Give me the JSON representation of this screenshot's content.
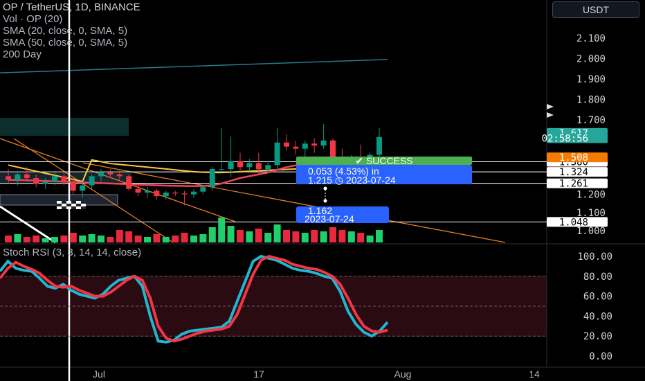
{
  "header": {
    "title": "OP / TetherUS, 1D, BINANCE",
    "indicators": [
      "Vol · OP (20)",
      "SMA (20, close, 0, SMA, 5)",
      "SMA (50, close, 0, SMA, 5)",
      "200 Day"
    ],
    "currency_button": "USDT"
  },
  "stoch_label": "Stoch RSI (3, 3, 14, 14, close)",
  "colors": {
    "up": "#26e07f",
    "down": "#f23645",
    "up_candle": "#089981",
    "down_candle": "#f23645",
    "sma20": "#f2425a",
    "sma50": "#f7c948",
    "ma200": "#2a7a8c",
    "stoch_k": "#21b6d0",
    "stoch_d": "#f23645",
    "accent_blue": "#2962ff",
    "success_green": "#4caf50"
  },
  "chart_data": [
    {
      "type": "candlestick",
      "title": "OP / TetherUS, 1D, BINANCE",
      "y_ticks": [
        "2.100",
        "2.000",
        "1.900",
        "1.800",
        "1.700",
        "1.200",
        "1.100",
        "1.000"
      ],
      "ylim": [
        0.98,
        2.22
      ],
      "x_ticks": [
        "Jul",
        "17",
        "Aug",
        "14"
      ],
      "candles": [
        {
          "o": 1.3,
          "h": 1.34,
          "l": 1.26,
          "c": 1.28
        },
        {
          "o": 1.28,
          "h": 1.33,
          "l": 1.25,
          "c": 1.31
        },
        {
          "o": 1.31,
          "h": 1.35,
          "l": 1.27,
          "c": 1.29
        },
        {
          "o": 1.29,
          "h": 1.31,
          "l": 1.24,
          "c": 1.26
        },
        {
          "o": 1.26,
          "h": 1.29,
          "l": 1.23,
          "c": 1.27
        },
        {
          "o": 1.27,
          "h": 1.32,
          "l": 1.25,
          "c": 1.3
        },
        {
          "o": 1.3,
          "h": 1.32,
          "l": 1.25,
          "c": 1.27
        },
        {
          "o": 1.27,
          "h": 1.29,
          "l": 1.2,
          "c": 1.22
        },
        {
          "o": 1.22,
          "h": 1.27,
          "l": 1.18,
          "c": 1.25
        },
        {
          "o": 1.25,
          "h": 1.31,
          "l": 1.23,
          "c": 1.3
        },
        {
          "o": 1.3,
          "h": 1.34,
          "l": 1.27,
          "c": 1.32
        },
        {
          "o": 1.32,
          "h": 1.34,
          "l": 1.29,
          "c": 1.31
        },
        {
          "o": 1.31,
          "h": 1.33,
          "l": 1.28,
          "c": 1.3
        },
        {
          "o": 1.3,
          "h": 1.31,
          "l": 1.22,
          "c": 1.23
        },
        {
          "o": 1.23,
          "h": 1.26,
          "l": 1.19,
          "c": 1.21
        },
        {
          "o": 1.21,
          "h": 1.24,
          "l": 1.18,
          "c": 1.22
        },
        {
          "o": 1.22,
          "h": 1.23,
          "l": 1.17,
          "c": 1.19
        },
        {
          "o": 1.19,
          "h": 1.22,
          "l": 1.17,
          "c": 1.21
        },
        {
          "o": 1.21,
          "h": 1.22,
          "l": 1.19,
          "c": 1.205
        },
        {
          "o": 1.205,
          "h": 1.22,
          "l": 1.14,
          "c": 1.2
        },
        {
          "o": 1.2,
          "h": 1.23,
          "l": 1.18,
          "c": 1.215
        },
        {
          "o": 1.215,
          "h": 1.25,
          "l": 1.2,
          "c": 1.24
        },
        {
          "o": 1.24,
          "h": 1.35,
          "l": 1.22,
          "c": 1.34
        },
        {
          "o": 1.34,
          "h": 1.66,
          "l": 1.33,
          "c": 1.46
        },
        {
          "o": 1.46,
          "h": 1.62,
          "l": 1.42,
          "c": 1.5
        },
        {
          "o": 1.5,
          "h": 1.54,
          "l": 1.44,
          "c": 1.47
        },
        {
          "o": 1.47,
          "h": 1.51,
          "l": 1.45,
          "c": 1.49
        },
        {
          "o": 1.49,
          "h": 1.54,
          "l": 1.43,
          "c": 1.46
        },
        {
          "o": 1.46,
          "h": 1.5,
          "l": 1.44,
          "c": 1.48
        },
        {
          "o": 1.48,
          "h": 1.66,
          "l": 1.46,
          "c": 1.59
        },
        {
          "o": 1.59,
          "h": 1.63,
          "l": 1.55,
          "c": 1.57
        },
        {
          "o": 1.57,
          "h": 1.6,
          "l": 1.53,
          "c": 1.56
        },
        {
          "o": 1.56,
          "h": 1.6,
          "l": 1.52,
          "c": 1.585
        },
        {
          "o": 1.585,
          "h": 1.61,
          "l": 1.54,
          "c": 1.575
        },
        {
          "o": 1.575,
          "h": 1.68,
          "l": 1.56,
          "c": 1.6
        },
        {
          "o": 1.6,
          "h": 1.61,
          "l": 1.5,
          "c": 1.52
        },
        {
          "o": 1.52,
          "h": 1.56,
          "l": 1.47,
          "c": 1.5
        },
        {
          "o": 1.5,
          "h": 1.53,
          "l": 1.46,
          "c": 1.52
        },
        {
          "o": 1.52,
          "h": 1.58,
          "l": 1.49,
          "c": 1.515
        },
        {
          "o": 1.515,
          "h": 1.54,
          "l": 1.49,
          "c": 1.53
        },
        {
          "o": 1.53,
          "h": 1.66,
          "l": 1.52,
          "c": 1.617
        }
      ],
      "volume": [
        5,
        6,
        4,
        5,
        3,
        4,
        5,
        7,
        5,
        6,
        5,
        4,
        9,
        8,
        5,
        4,
        6,
        4,
        5,
        7,
        5,
        6,
        11,
        18,
        12,
        9,
        8,
        10,
        7,
        13,
        9,
        8,
        7,
        9,
        8,
        11,
        9,
        8,
        7,
        5,
        9
      ],
      "sma20": [
        1.28,
        1.279,
        1.278,
        1.276,
        1.274,
        1.272,
        1.27,
        1.268,
        1.266,
        1.264,
        1.262,
        1.26,
        1.258,
        1.256,
        1.254,
        1.252,
        1.25,
        1.248,
        1.247,
        1.246,
        1.245,
        1.246,
        1.25,
        1.26,
        1.275,
        1.29,
        1.3,
        1.31,
        1.32,
        1.335,
        1.35,
        1.36,
        1.37,
        1.38,
        1.39,
        1.4,
        1.41,
        1.42,
        1.43,
        1.44,
        1.45
      ],
      "sma50": [
        1.48,
        1.47,
        1.46,
        1.45,
        1.44,
        1.43,
        1.42,
        1.41,
        1.4,
        1.39,
        1.38,
        1.37,
        1.365,
        1.36,
        1.355,
        1.35,
        1.345,
        1.34,
        1.335,
        1.33,
        1.325,
        1.322,
        1.32,
        1.32,
        1.322,
        1.325,
        1.328,
        1.33,
        1.333,
        1.335,
        1.338,
        1.34,
        1.343,
        1.345,
        1.348,
        1.35,
        1.352,
        1.355,
        1.357,
        1.36,
        1.362
      ],
      "ma200_left": 1.93,
      "ma200_right": 1.995,
      "price_levels": [
        1.38,
        1.324,
        1.261,
        1.048
      ],
      "price_tags": [
        {
          "label": "1.380",
          "price": 1.38,
          "style": "line"
        },
        {
          "label": "1.324",
          "price": 1.324,
          "style": "line"
        },
        {
          "label": "1.261",
          "price": 1.261,
          "style": "line"
        },
        {
          "label": "1.048",
          "price": 1.048,
          "style": "line"
        },
        {
          "label": "1.617",
          "price": 1.637,
          "style": "green"
        },
        {
          "label": "02:58:56",
          "price": 1.611,
          "style": "green"
        },
        {
          "label": "1.508",
          "price": 1.518,
          "style": "orange"
        }
      ],
      "measure_boxes": [
        {
          "label": "✔ SUCCESS",
          "style": "success"
        },
        {
          "label": "0.053 (4.53%) in",
          "style": "blue"
        },
        {
          "label": "1.215 ◷ 2023-07-24",
          "style": "blue"
        },
        {
          "label": "1.162",
          "style": "blue"
        },
        {
          "label": "2023-07-24",
          "style": "blue"
        }
      ]
    },
    {
      "type": "line",
      "title": "Stoch RSI (3, 3, 14, 14, close)",
      "y_ticks": [
        "100.00",
        "80.00",
        "60.00",
        "40.00",
        "20.00",
        "0.00"
      ],
      "ylim": [
        0,
        100
      ],
      "series": [
        {
          "values": [
            85,
            95,
            88,
            86,
            85,
            78,
            70,
            68,
            72,
            66,
            62,
            60,
            58,
            62,
            70,
            76,
            78,
            80,
            70,
            40,
            15,
            14,
            16,
            22,
            25,
            26,
            27,
            28,
            29,
            35,
            55,
            75,
            95,
            100,
            98,
            96,
            92,
            88,
            86,
            85,
            83,
            80,
            78,
            65,
            45,
            32,
            24,
            20,
            25,
            34
          ]
        },
        {
          "values": [
            78,
            88,
            94,
            90,
            87,
            83,
            76,
            70,
            69,
            70,
            66,
            63,
            60,
            60,
            64,
            70,
            76,
            80,
            76,
            58,
            30,
            18,
            15,
            17,
            20,
            23,
            25,
            26,
            27,
            30,
            42,
            62,
            82,
            96,
            100,
            98,
            96,
            92,
            90,
            88,
            87,
            84,
            80,
            72,
            58,
            42,
            30,
            25,
            24,
            26
          ]
        }
      ]
    }
  ]
}
